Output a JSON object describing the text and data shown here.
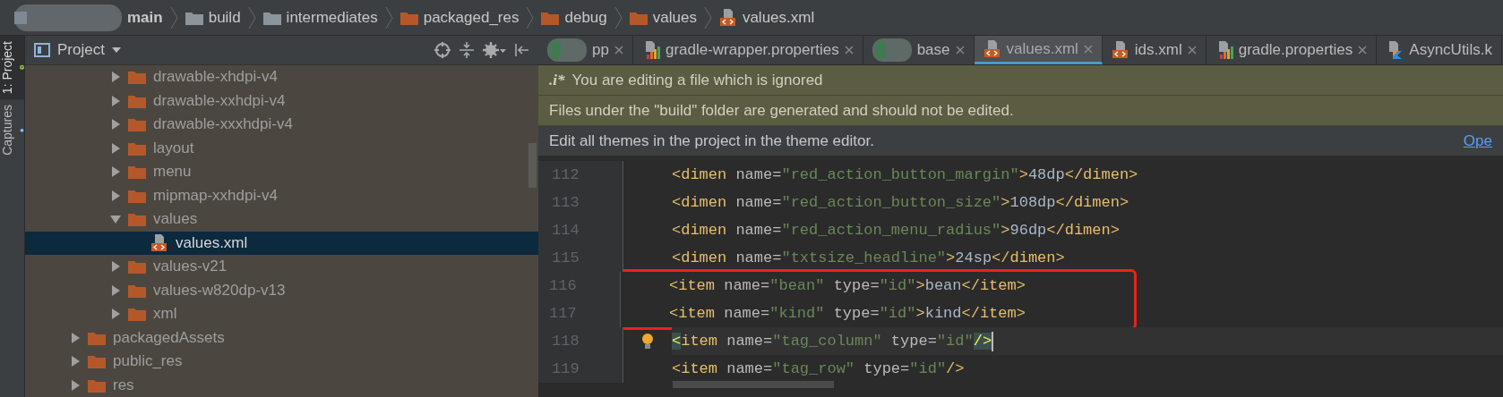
{
  "breadcrumb": [
    {
      "label": "main",
      "kind": "redacted"
    },
    {
      "label": "build",
      "kind": "folder",
      "color": "#8c959c"
    },
    {
      "label": "intermediates",
      "kind": "folder",
      "color": "#8c959c"
    },
    {
      "label": "packaged_res",
      "kind": "folder",
      "color": "#b4582a"
    },
    {
      "label": "debug",
      "kind": "folder",
      "color": "#b4582a"
    },
    {
      "label": "values",
      "kind": "folder",
      "color": "#b4582a"
    },
    {
      "label": "values.xml",
      "kind": "xml"
    }
  ],
  "side_tabs": [
    {
      "label": "1: Project",
      "kind": "android",
      "selected": true
    },
    {
      "label": "Captures",
      "kind": "captures",
      "selected": false
    }
  ],
  "project_panel": {
    "title": "Project",
    "tree": [
      {
        "children": [
          {
            "label": "drawable-xhdpi-v4",
            "expanded": false,
            "selected": false
          },
          {
            "label": "drawable-xxhdpi-v4",
            "expanded": false,
            "selected": false
          },
          {
            "label": "drawable-xxxhdpi-v4",
            "expanded": false,
            "selected": false
          },
          {
            "label": "layout",
            "expanded": false,
            "selected": false
          },
          {
            "label": "menu",
            "expanded": false,
            "selected": false
          },
          {
            "label": "mipmap-xxhdpi-v4",
            "expanded": false,
            "selected": false
          },
          {
            "label": "values",
            "expanded": true,
            "selected": false,
            "children": [
              {
                "label": "values.xml",
                "kind": "xml",
                "selected": true
              }
            ]
          },
          {
            "label": "values-v21",
            "expanded": false,
            "selected": false
          },
          {
            "label": "values-w820dp-v13",
            "expanded": false,
            "selected": false
          },
          {
            "label": "xml",
            "expanded": false,
            "selected": false
          }
        ]
      },
      {
        "label": "packagedAssets",
        "expanded": false,
        "selected": false
      },
      {
        "label": "public_res",
        "expanded": false,
        "selected": false
      },
      {
        "label": "res",
        "expanded": false,
        "selected": false
      }
    ]
  },
  "tabs": [
    {
      "label": "pp",
      "kind": "redacted",
      "selected": false
    },
    {
      "label": "gradle-wrapper.properties",
      "kind": "gradle",
      "selected": false
    },
    {
      "label": "base",
      "kind": "redacted",
      "selected": false
    },
    {
      "label": "values.xml",
      "kind": "xml",
      "selected": true
    },
    {
      "label": "ids.xml",
      "kind": "xml",
      "selected": false
    },
    {
      "label": "gradle.properties",
      "kind": "gradle",
      "selected": false
    },
    {
      "label": "AsyncUtils.k",
      "kind": "kotlin",
      "selected": false
    }
  ],
  "banners": [
    {
      "kind": "warning",
      "icon": ".i*",
      "text": "You are editing a file which is ignored"
    },
    {
      "kind": "warning",
      "text": "Files under the \"build\" folder are generated and should not be edited."
    },
    {
      "kind": "info",
      "text": "Edit all themes in the project in the theme editor.",
      "link": "Ope"
    }
  ],
  "code": {
    "lines": [
      {
        "number": "112",
        "boxed": false,
        "current": false,
        "tokens": [
          {
            "kind": "tag",
            "text": "<dimen"
          },
          {
            "kind": "attr",
            "text": " name="
          },
          {
            "kind": "string",
            "text": "\"red_action_button_margin\""
          },
          {
            "kind": "tag",
            "text": ">"
          },
          {
            "kind": "text",
            "text": "48dp"
          },
          {
            "kind": "tag",
            "text": "</dimen>"
          }
        ]
      },
      {
        "number": "113",
        "boxed": false,
        "current": false,
        "tokens": [
          {
            "kind": "tag",
            "text": "<dimen"
          },
          {
            "kind": "attr",
            "text": " name="
          },
          {
            "kind": "string",
            "text": "\"red_action_button_size\""
          },
          {
            "kind": "tag",
            "text": ">"
          },
          {
            "kind": "text",
            "text": "108dp"
          },
          {
            "kind": "tag",
            "text": "</dimen>"
          }
        ]
      },
      {
        "number": "114",
        "boxed": false,
        "current": false,
        "tokens": [
          {
            "kind": "tag",
            "text": "<dimen"
          },
          {
            "kind": "attr",
            "text": " name="
          },
          {
            "kind": "string",
            "text": "\"red_action_menu_radius\""
          },
          {
            "kind": "tag",
            "text": ">"
          },
          {
            "kind": "text",
            "text": "96dp"
          },
          {
            "kind": "tag",
            "text": "</dimen>"
          }
        ]
      },
      {
        "number": "115",
        "boxed": false,
        "current": false,
        "tokens": [
          {
            "kind": "tag",
            "text": "<dimen"
          },
          {
            "kind": "attr",
            "text": " name="
          },
          {
            "kind": "string",
            "text": "\"txtsize_headline\""
          },
          {
            "kind": "tag",
            "text": ">"
          },
          {
            "kind": "text",
            "text": "24sp"
          },
          {
            "kind": "tag",
            "text": "</dimen>"
          }
        ]
      },
      {
        "number": "116",
        "boxed": true,
        "current": false,
        "tokens": [
          {
            "kind": "tag",
            "text": "<item"
          },
          {
            "kind": "attr",
            "text": " name="
          },
          {
            "kind": "string",
            "text": "\"bean\""
          },
          {
            "kind": "attr",
            "text": " type="
          },
          {
            "kind": "string",
            "text": "\"id\""
          },
          {
            "kind": "tag",
            "text": ">"
          },
          {
            "kind": "text",
            "text": "bean"
          },
          {
            "kind": "tag",
            "text": "</item>"
          }
        ]
      },
      {
        "number": "117",
        "boxed": true,
        "current": false,
        "tokens": [
          {
            "kind": "tag",
            "text": "<item"
          },
          {
            "kind": "attr",
            "text": " name="
          },
          {
            "kind": "string",
            "text": "\"kind\""
          },
          {
            "kind": "attr",
            "text": " type="
          },
          {
            "kind": "string",
            "text": "\"id\""
          },
          {
            "kind": "tag",
            "text": ">"
          },
          {
            "kind": "text",
            "text": "kind"
          },
          {
            "kind": "tag",
            "text": "</item>"
          }
        ]
      },
      {
        "number": "118",
        "boxed": false,
        "current": true,
        "tokens": [
          {
            "kind": "match",
            "text": "<"
          },
          {
            "kind": "tag",
            "text": "item"
          },
          {
            "kind": "attr",
            "text": " name="
          },
          {
            "kind": "string",
            "text": "\"tag_column\""
          },
          {
            "kind": "attr",
            "text": " type="
          },
          {
            "kind": "string",
            "text": "\"id\""
          },
          {
            "kind": "match",
            "text": "/>"
          }
        ]
      },
      {
        "number": "119",
        "boxed": false,
        "current": false,
        "tokens": [
          {
            "kind": "tag",
            "text": "<item"
          },
          {
            "kind": "attr",
            "text": " name="
          },
          {
            "kind": "string",
            "text": "\"tag_row\""
          },
          {
            "kind": "attr",
            "text": " type="
          },
          {
            "kind": "string",
            "text": "\"id\""
          },
          {
            "kind": "tag",
            "text": "/>"
          }
        ]
      }
    ]
  }
}
